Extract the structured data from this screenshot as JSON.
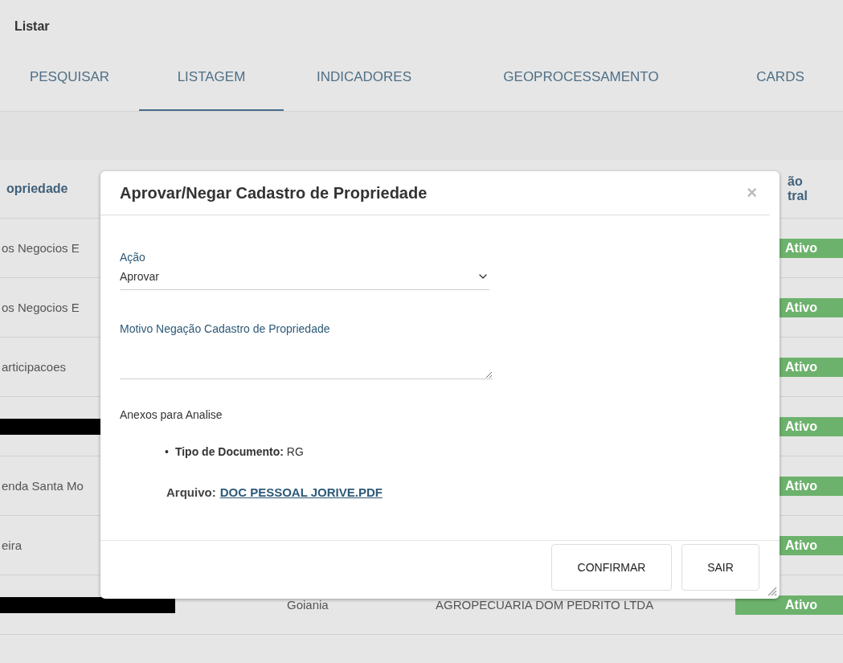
{
  "page": {
    "title": "Listar"
  },
  "tabs": [
    {
      "label": "PESQUISAR",
      "selected": false
    },
    {
      "label": "LISTAGEM",
      "selected": true
    },
    {
      "label": "INDICADORES",
      "selected": false
    },
    {
      "label": "GEOPROCESSAMENTO",
      "selected": false
    },
    {
      "label": "CARDS",
      "selected": false
    }
  ],
  "table": {
    "columns": [
      "opriedade",
      "",
      "",
      [
        "ão",
        "tral"
      ]
    ],
    "rows": [
      {
        "column_1": "os Negocios E",
        "redacted": false,
        "status": "Ativo"
      },
      {
        "column_1": "os Negocios E",
        "redacted": false,
        "status": "Ativo"
      },
      {
        "column_1": "articipacoes",
        "redacted": false,
        "status": "Ativo"
      },
      {
        "column_1": "",
        "redacted": true,
        "status": "Ativo"
      },
      {
        "column_1": "enda Santa Mo",
        "redacted": false,
        "status": "Ativo"
      },
      {
        "column_1": "eira",
        "redacted": false,
        "status": "Ativo"
      },
      {
        "column_1": "",
        "redacted": true,
        "column_2": "Goiania",
        "column_3": "AGROPECUARIA DOM PEDRITO LTDA",
        "status": "Ativo"
      }
    ]
  },
  "dialog": {
    "title": "Aprovar/Negar Cadastro de Propriedade",
    "close": "×",
    "action": {
      "label": "Ação",
      "value": "Aprovar"
    },
    "reason": {
      "label": "Motivo Negação Cadastro de Propriedade"
    },
    "attachments": {
      "title": "Anexos para Analise",
      "items": [
        {
          "bullet": "•",
          "text": "**Tipo de Documento:** RG",
          "file_label": "Arquivo:",
          "file": "DOC PESSOAL JORIVE.PDF"
        }
      ]
    },
    "buttons": [
      "CONFIRMAR",
      "SAIR"
    ]
  }
}
